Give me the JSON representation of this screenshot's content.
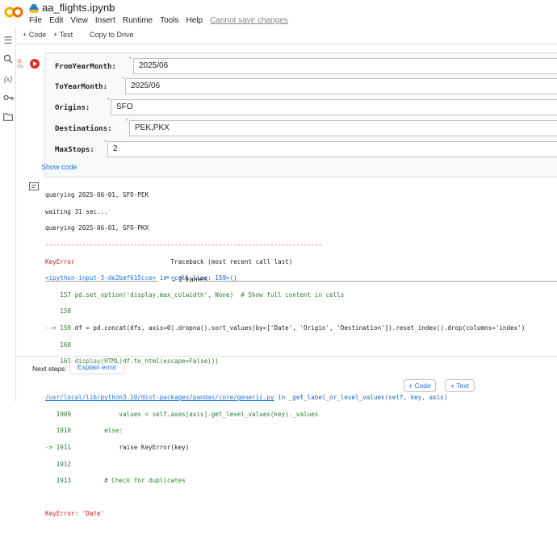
{
  "header": {
    "filename": "aa_flights.ipynb",
    "menu": [
      "File",
      "Edit",
      "View",
      "Insert",
      "Runtime",
      "Tools",
      "Help"
    ],
    "save_status": "Cannot save changes"
  },
  "toolbar": {
    "code_label": "+ Code",
    "text_label": "+ Text",
    "copy_label": "Copy to Drive"
  },
  "cell": {
    "exec_badge_line1": "20s",
    "form": {
      "fields": [
        {
          "label": "FromYearMonth:",
          "value": "2025/06"
        },
        {
          "label": "ToYearMonth:",
          "value": "2025/06"
        },
        {
          "label": "Origins:",
          "value": "SFO"
        },
        {
          "label": "Destinations:",
          "value": "PEK,PKX"
        },
        {
          "label": "MaxStops:",
          "value": "2"
        }
      ],
      "show_code": "Show code"
    }
  },
  "output": {
    "lines": [
      "querying 2025-06-01, SFO-PEK",
      "waiting 31 sec...",
      "querying 2025-06-01, SFO-PKX"
    ],
    "separator": "---------------------------------------------------------------------------",
    "error_name": "KeyError",
    "traceback_header": "Traceback (most recent call last)",
    "ipython_link": "<ipython-input-3-de2bef615cce>",
    "in_cell_line": " in <cell line: 159>()",
    "l157": "    157 pd.set_option('display.max_colwidth', None)  # Show full content in cells",
    "l158": "    158",
    "l159_arrow": "--> 159 ",
    "l159": "df = pd.concat(dfs, axis=0).dropna().sort_values(by=['Date', 'Origin', 'Destination']).reset_index().drop(columns='index')",
    "l160": "    160",
    "l161": "    161 display(HTML(df.to_html(escape=False)))",
    "frames_label": "2 frames",
    "generic_link": "/usr/local/lib/python3.10/dist-packages/pandas/core/generic.py",
    "generic_in": " in _get_label_or_level_values(self, key, axis)",
    "l1909": "   1909             values = self.axes[axis].get_level_values(key)._values",
    "l1910": "   1910         else:",
    "l1911_arrow": "-> 1911 ",
    "l1911": "            raise KeyError(key)",
    "l1912": "   1912",
    "l1913": "   1913         # Check for duplicates",
    "final_error": "KeyError: 'Date'"
  },
  "next_steps": {
    "label": "Next steps:",
    "explain_button": "Explain error"
  },
  "bottom_buttons": {
    "code": "+ Code",
    "text": "+ Text"
  }
}
